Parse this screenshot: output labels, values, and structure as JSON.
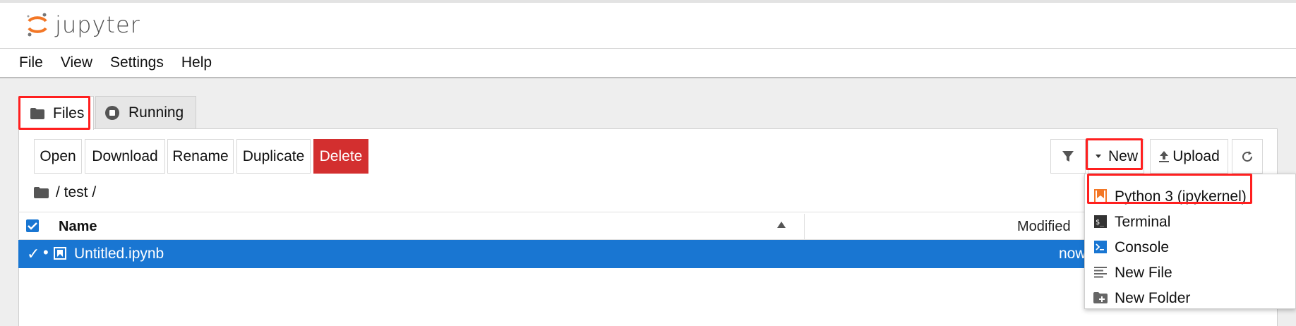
{
  "app": {
    "logo_text": "jupyter"
  },
  "menubar": {
    "items": [
      "File",
      "View",
      "Settings",
      "Help"
    ]
  },
  "tabs": [
    {
      "label": "Files",
      "icon": "folder-icon",
      "active": true
    },
    {
      "label": "Running",
      "icon": "stop-circle-icon",
      "active": false
    }
  ],
  "toolbar": {
    "open": "Open",
    "download": "Download",
    "rename": "Rename",
    "duplicate": "Duplicate",
    "delete": "Delete",
    "new": "New",
    "upload": "Upload"
  },
  "breadcrumb": {
    "path": "/ test /"
  },
  "file_list": {
    "columns": {
      "name": "Name",
      "modified": "Modified"
    },
    "rows": [
      {
        "name": "Untitled.ipynb",
        "modified": "now",
        "selected": true
      }
    ]
  },
  "new_menu": {
    "items": [
      {
        "label": "Python 3 (ipykernel)",
        "icon": "notebook-icon"
      },
      {
        "label": "Terminal",
        "icon": "terminal-icon"
      },
      {
        "label": "Console",
        "icon": "console-icon"
      },
      {
        "label": "New File",
        "icon": "text-file-icon"
      },
      {
        "label": "New Folder",
        "icon": "new-folder-icon"
      }
    ]
  },
  "colors": {
    "accent": "#1976d2",
    "danger": "#d32f2f",
    "highlight": "#ff1f1f",
    "notebook_orange": "#f37726"
  }
}
